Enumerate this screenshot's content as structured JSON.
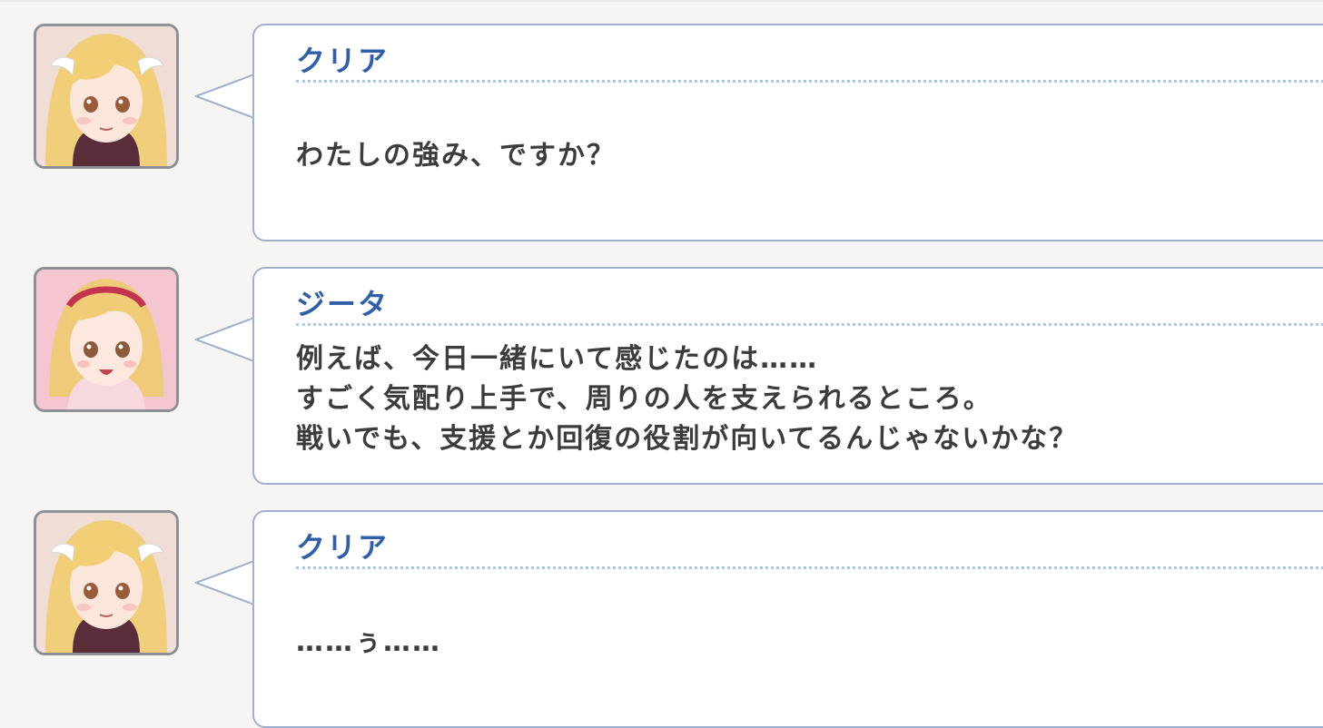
{
  "entries": [
    {
      "speaker": "クリア",
      "avatar": "clair-portrait",
      "lines": [
        "わたしの強み、ですか？"
      ]
    },
    {
      "speaker": "ジータ",
      "avatar": "djeeta-portrait",
      "lines": [
        "例えば、今日一緒にいて感じたのは……",
        "すごく気配り上手で、周りの人を支えられるところ。",
        "戦いでも、支援とか回復の役割が向いてるんじゃないかな？"
      ]
    },
    {
      "speaker": "クリア",
      "avatar": "clair-portrait",
      "lines": [
        "……ぅ……"
      ]
    }
  ],
  "colors": {
    "background": "#f7f5f3",
    "bubble_border": "#9fb0cf",
    "speaker_name": "#2f5fa8",
    "dialogue_text": "#3c3c3c",
    "divider": "#a9c8e8"
  }
}
